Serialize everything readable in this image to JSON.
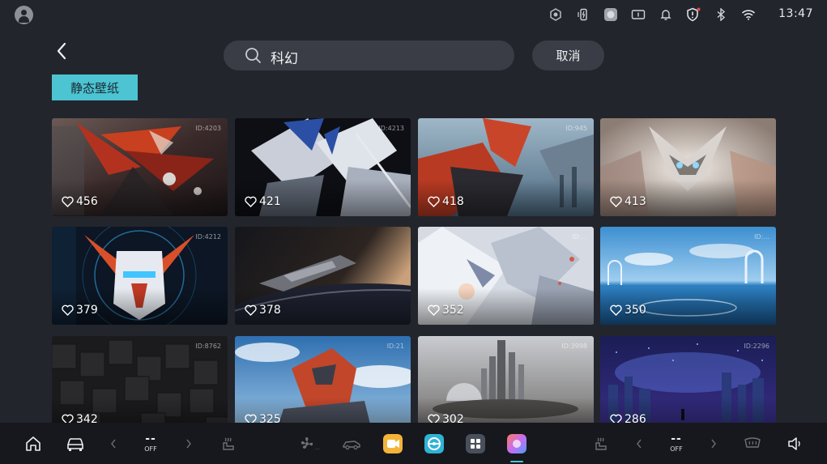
{
  "status_bar": {
    "time": "13:47",
    "icons": [
      "camera-hub-icon",
      "phone-charging-icon",
      "app-thumbnail-icon",
      "recorder-icon",
      "bell-icon",
      "shield-alert-icon",
      "bluetooth-icon",
      "wifi-icon"
    ]
  },
  "header": {
    "search_query": "科幻",
    "cancel_label": "取消",
    "category_label": "静态壁纸"
  },
  "colors": {
    "background": "#23252c",
    "accent": "#4cc4d2",
    "search_bg": "#3a3d45",
    "dock_bg": "#17181d"
  },
  "wallpapers": [
    {
      "id_label": "ID:4203",
      "likes": "456",
      "theme": "red-mecha-closeup"
    },
    {
      "id_label": "ID:4213",
      "likes": "421",
      "theme": "white-blue-mecha"
    },
    {
      "id_label": "ID:945",
      "likes": "418",
      "theme": "red-mecha-city"
    },
    {
      "id_label": "",
      "likes": "413",
      "theme": "white-mecha-glow"
    },
    {
      "id_label": "ID:4212",
      "likes": "379",
      "theme": "gundam-hud"
    },
    {
      "id_label": "",
      "likes": "378",
      "theme": "spaceship-planet"
    },
    {
      "id_label": "ID:...",
      "likes": "352",
      "theme": "white-mecha-explosion"
    },
    {
      "id_label": "ID:...",
      "likes": "350",
      "theme": "sky-ocean-arches"
    },
    {
      "id_label": "ID:8762",
      "likes": "342",
      "theme": "dark-cubes"
    },
    {
      "id_label": "ID:21",
      "likes": "325",
      "theme": "red-mecha-sky"
    },
    {
      "id_label": "ID:3998",
      "likes": "302",
      "theme": "futuristic-city"
    },
    {
      "id_label": "ID:2296",
      "likes": "286",
      "theme": "neon-night-city"
    }
  ],
  "dock": {
    "left_temp": {
      "value": "--",
      "state": "OFF"
    },
    "right_temp": {
      "value": "--",
      "state": "OFF"
    },
    "items": [
      "home-icon",
      "car-icon",
      "left-arrow-icon",
      "seat-heat-icon",
      "fan-icon",
      "car-mode-icon",
      "video-app",
      "steering-app",
      "apps-grid",
      "wallpaper-app",
      "seat-heat-right-icon",
      "right-arrow-icon",
      "rear-defrost-icon",
      "volume-icon"
    ]
  }
}
